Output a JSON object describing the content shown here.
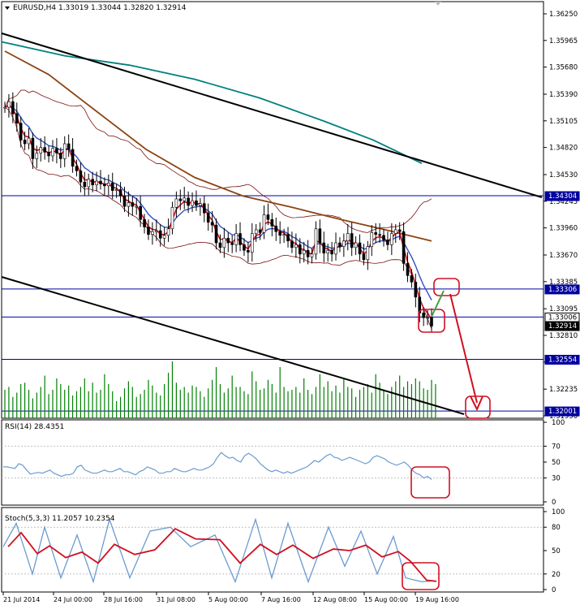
{
  "header": {
    "main": "EURUSD,H4  1.33019 1.33044 1.32820 1.32914",
    "rsi": "RSI(14) 28.4351",
    "stoch": "Stoch(5,3,3) 11.2057 10.2354"
  },
  "colors": {
    "accent_box": "#d01020",
    "hline": "#0000a0",
    "tag": "#0000a0",
    "candle": "#000000",
    "volume": "#008000",
    "ma_fast": "#d01020",
    "ma_mid": "#3050c0",
    "ma_slow": "#8b4513",
    "ma_long": "#008080",
    "bands": "#7a1010",
    "osc_main": "#6b9bd0",
    "osc_signal": "#d01020",
    "forecast_up": "#40a040",
    "forecast_down": "#d01020"
  },
  "chart_data": [
    {
      "type": "candlestick",
      "symbol": "EURUSD",
      "timeframe": "H4",
      "ohlc_last": {
        "open": 1.33019,
        "high": 1.33044,
        "low": 1.3282,
        "close": 1.32914
      },
      "y_ticks": [
        "1.36250",
        "1.35965",
        "1.35680",
        "1.35390",
        "1.35105",
        "1.34820",
        "1.34530",
        "1.34245",
        "1.33960",
        "1.33670",
        "1.33385",
        "1.33095",
        "1.32810",
        "1.32525",
        "1.32235",
        "1.31950"
      ],
      "ylim": [
        1.3195,
        1.3625
      ],
      "x_labels": [
        "21 Jul 2014",
        "24 Jul 00:00",
        "28 Jul 16:00",
        "31 Jul 08:00",
        "5 Aug 00:00",
        "7 Aug 16:00",
        "12 Aug 08:00",
        "15 Aug 00:00",
        "19 Aug 16:00"
      ],
      "price_tags": [
        {
          "label": "1.34304",
          "value": 1.34304,
          "style": "blue"
        },
        {
          "label": "1.33306",
          "value": 1.33306,
          "style": "blue"
        },
        {
          "label": "1.33006",
          "value": 1.33006,
          "style": "white"
        },
        {
          "label": "1.32914",
          "value": 1.32914,
          "style": "black"
        },
        {
          "label": "1.32554",
          "value": 1.32554,
          "style": "blue"
        },
        {
          "label": "1.32001",
          "value": 1.32001,
          "style": "blue"
        }
      ],
      "horizontal_levels": [
        1.34304,
        1.33306,
        1.33006,
        1.32554,
        1.32001
      ],
      "closes": [
        1.3525,
        1.3531,
        1.3518,
        1.3508,
        1.349,
        1.3486,
        1.3492,
        1.347,
        1.3476,
        1.3482,
        1.3477,
        1.3473,
        1.3481,
        1.3476,
        1.347,
        1.3486,
        1.348,
        1.3462,
        1.3457,
        1.3445,
        1.344,
        1.3448,
        1.3442,
        1.3446,
        1.3443,
        1.3441,
        1.3444,
        1.3436,
        1.3437,
        1.343,
        1.3419,
        1.3423,
        1.3419,
        1.3419,
        1.3405,
        1.3397,
        1.3389,
        1.3392,
        1.3393,
        1.3385,
        1.3388,
        1.3395,
        1.3418,
        1.3427,
        1.3425,
        1.3428,
        1.342,
        1.3425,
        1.342,
        1.3422,
        1.3412,
        1.3402,
        1.3399,
        1.338,
        1.3375,
        1.3385,
        1.338,
        1.3378,
        1.339,
        1.3378,
        1.3372,
        1.337,
        1.339,
        1.3394,
        1.3391,
        1.341,
        1.3405,
        1.3398,
        1.3392,
        1.3388,
        1.3389,
        1.3382,
        1.3375,
        1.3378,
        1.3368,
        1.3372,
        1.3365,
        1.3368,
        1.3395,
        1.338,
        1.3369,
        1.3372,
        1.3368,
        1.338,
        1.3376,
        1.3382,
        1.339,
        1.3375,
        1.338,
        1.3368,
        1.3362,
        1.3376,
        1.3391,
        1.3389,
        1.3388,
        1.3383,
        1.3378,
        1.339,
        1.3394,
        1.3392,
        1.3358,
        1.3345,
        1.3338,
        1.3322,
        1.3305,
        1.33,
        1.33,
        1.3291
      ],
      "volume": [
        20,
        22,
        15,
        18,
        24,
        25,
        20,
        14,
        18,
        22,
        30,
        17,
        20,
        28,
        24,
        20,
        23,
        16,
        19,
        22,
        28,
        19,
        25,
        18,
        20,
        31,
        24,
        19,
        12,
        15,
        21,
        26,
        22,
        15,
        17,
        20,
        27,
        23,
        18,
        16,
        24,
        32,
        40,
        25,
        20,
        22,
        18,
        23,
        22,
        19,
        15,
        21,
        27,
        36,
        24,
        18,
        21,
        30,
        22,
        22,
        19,
        17,
        33,
        26,
        20,
        21,
        27,
        24,
        18,
        36,
        22,
        19,
        20,
        22,
        18,
        28,
        20,
        17,
        22,
        31,
        22,
        26,
        19,
        23,
        18,
        28,
        22,
        21,
        15,
        20,
        22,
        24,
        18,
        31,
        25,
        20,
        17,
        22,
        26,
        30,
        22,
        26,
        24,
        28,
        26,
        21,
        20,
        27,
        24
      ]
    },
    {
      "type": "line",
      "name": "RSI(14)",
      "value": 28.4351,
      "y_ticks": [
        "100",
        "70",
        "50",
        "30",
        "0"
      ],
      "ylim": [
        0,
        100
      ],
      "values": [
        44,
        44,
        43,
        42,
        48,
        46,
        40,
        35,
        36,
        37,
        36,
        38,
        40,
        36,
        34,
        32,
        34,
        34,
        36,
        44,
        46,
        40,
        38,
        36,
        36,
        38,
        40,
        38,
        38,
        40,
        42,
        38,
        38,
        36,
        34,
        38,
        40,
        44,
        42,
        40,
        36,
        36,
        38,
        38,
        42,
        40,
        38,
        38,
        40,
        42,
        40,
        40,
        42,
        44,
        48,
        56,
        62,
        58,
        55,
        56,
        52,
        50,
        58,
        61,
        58,
        54,
        48,
        44,
        40,
        38,
        40,
        38,
        36,
        38,
        36,
        38,
        40,
        42,
        44,
        48,
        52,
        50,
        54,
        58,
        60,
        56,
        55,
        52,
        54,
        56,
        54,
        52,
        50,
        48,
        50,
        56,
        58,
        56,
        54,
        50,
        48,
        46,
        48,
        50,
        46,
        40,
        36,
        34,
        30,
        32,
        28
      ]
    },
    {
      "type": "line",
      "name": "Stoch(5,3,3)",
      "main": 11.2057,
      "signal": 10.2354,
      "y_ticks": [
        "100",
        "80",
        "50",
        "20",
        "0"
      ],
      "ylim": [
        0,
        100
      ]
    }
  ]
}
